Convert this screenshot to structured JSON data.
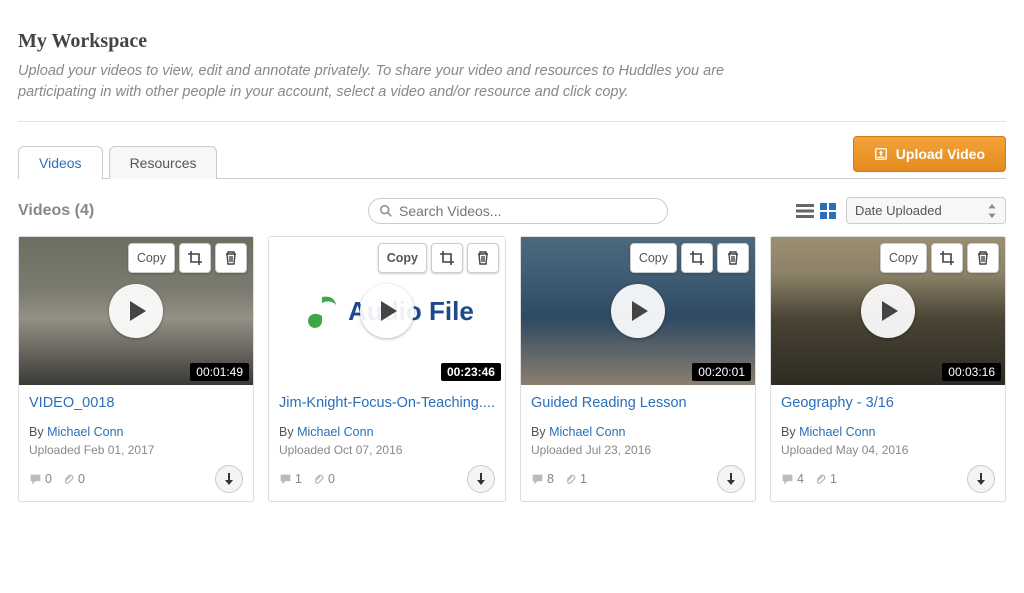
{
  "header": {
    "title": "My Workspace",
    "subtitle": "Upload your videos to view, edit and annotate privately. To share your video and resources to Huddles you are participating in with other people in your account, select a video and/or resource and click copy."
  },
  "tabs": {
    "videos": "Videos",
    "resources": "Resources"
  },
  "upload_button": "Upload Video",
  "count_label": "Videos (4)",
  "search": {
    "placeholder": "Search Videos..."
  },
  "sort_label": "Date Uploaded",
  "copy_label": "Copy",
  "by_label": "By",
  "author": "Michael Conn",
  "videos": [
    {
      "title": "VIDEO_0018",
      "duration": "00:01:49",
      "uploaded": "Uploaded Feb 01, 2017",
      "comments": "0",
      "attachments": "0"
    },
    {
      "title": "Jim-Knight-Focus-On-Teaching....",
      "duration": "00:23:46",
      "uploaded": "Uploaded Oct 07, 2016",
      "comments": "1",
      "attachments": "0",
      "audio_label": "Audio File"
    },
    {
      "title": "Guided Reading Lesson",
      "duration": "00:20:01",
      "uploaded": "Uploaded Jul 23, 2016",
      "comments": "8",
      "attachments": "1"
    },
    {
      "title": "Geography - 3/16",
      "duration": "00:03:16",
      "uploaded": "Uploaded May 04, 2016",
      "comments": "4",
      "attachments": "1"
    }
  ]
}
